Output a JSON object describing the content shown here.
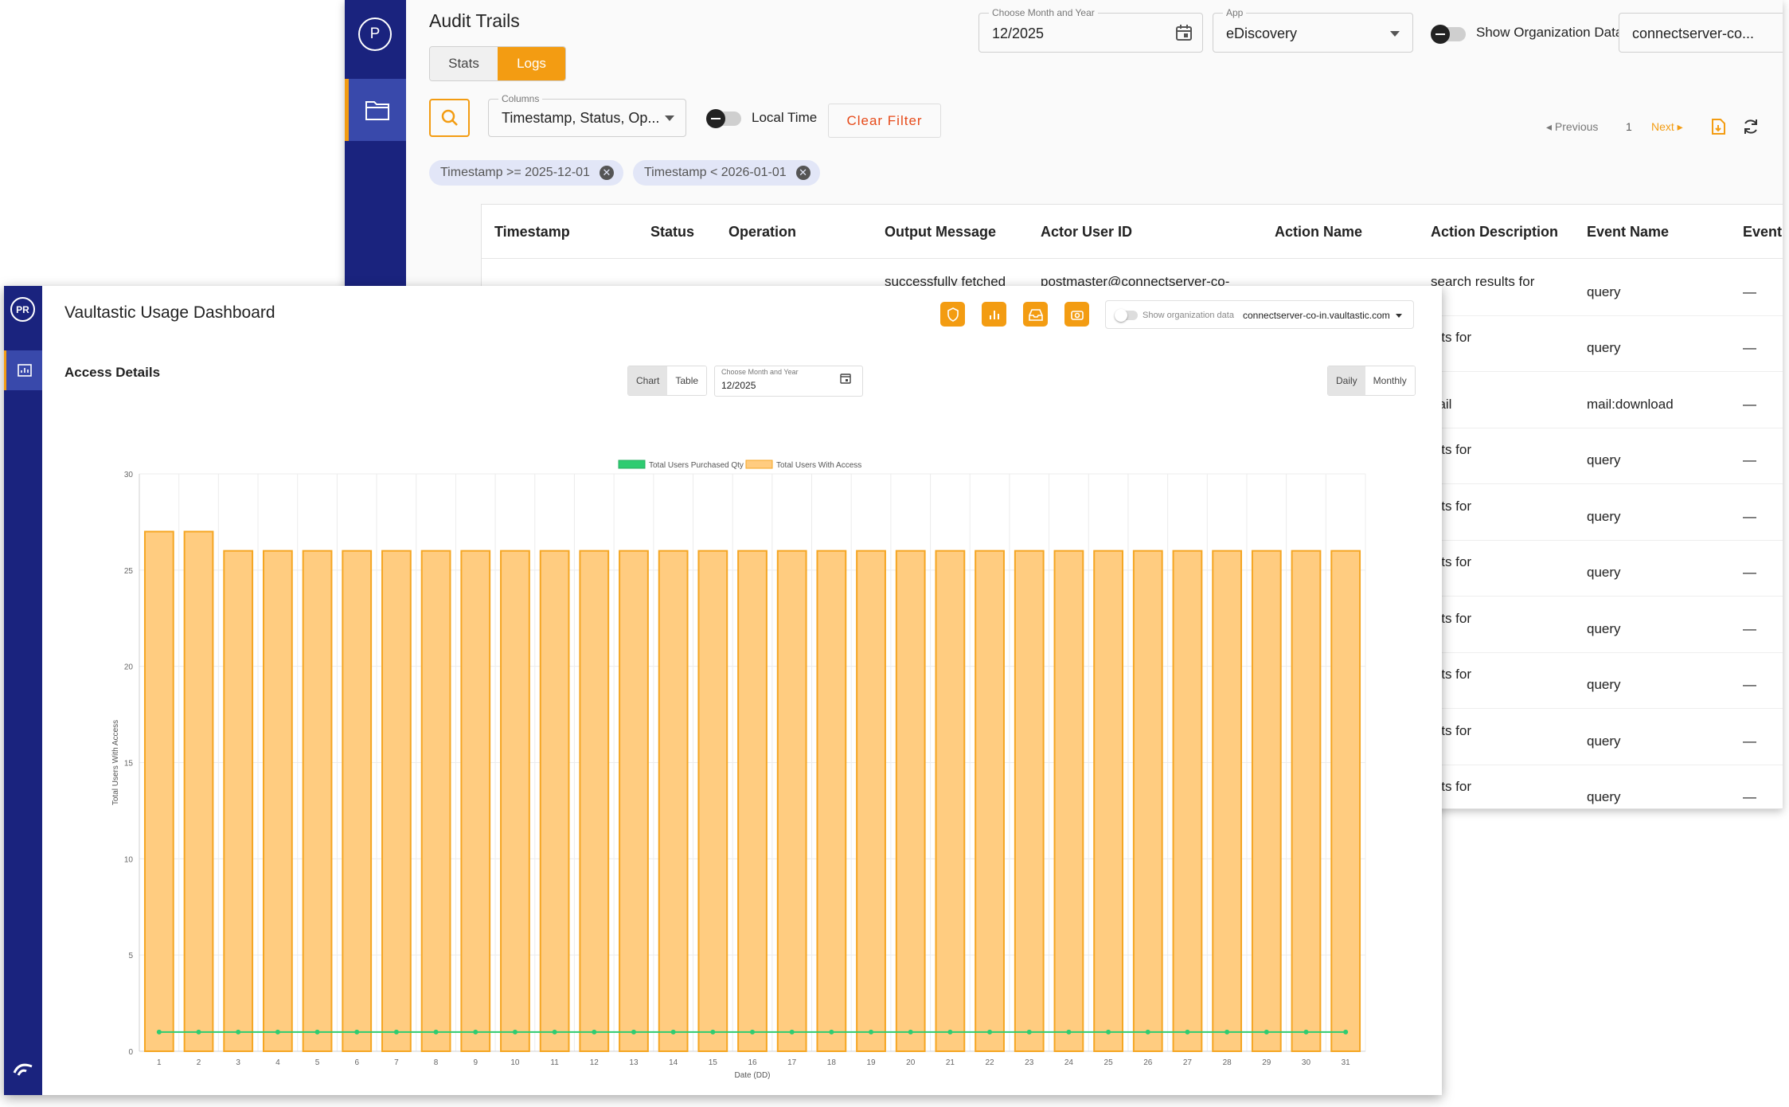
{
  "audit": {
    "rail_badge": "P",
    "title": "Audit Trails",
    "tabs": [
      "Stats",
      "Logs"
    ],
    "month_field": {
      "label": "Choose Month and Year",
      "value": "12/2025"
    },
    "app_field": {
      "label": "App",
      "value": "eDiscovery"
    },
    "org_toggle_label": "Show Organization Data",
    "org_select": "connectserver-co...",
    "columns_field": {
      "label": "Columns",
      "value": "Timestamp, Status, Op..."
    },
    "local_time_label": "Local Time",
    "clear_filter": "Clear Filter",
    "pager": {
      "previous": "Previous",
      "page": "1",
      "next": "Next"
    },
    "filters": [
      "Timestamp >= 2025-12-01",
      "Timestamp < 2026-01-01"
    ],
    "table": {
      "headers": [
        "Timestamp",
        "Status",
        "Operation",
        "Output Message",
        "Actor User ID",
        "Action Name",
        "Action Description",
        "Event Name",
        "Event Sourc"
      ],
      "first_row": {
        "output": "successfully fetched",
        "actor": "postmaster@connectserver-co-",
        "desc": "search results for",
        "event": "query",
        "source": "—"
      },
      "rows": [
        {
          "desc": "ults for",
          "event": "query",
          "source": "—"
        },
        {
          "desc": "nail",
          "event": "mail:download",
          "source": "—"
        },
        {
          "desc": "ults for",
          "event": "query",
          "source": "—"
        },
        {
          "desc": "ults for",
          "event": "query",
          "source": "—"
        },
        {
          "desc": "ults for",
          "event": "query",
          "source": "—"
        },
        {
          "desc": "ults for",
          "event": "query",
          "source": "—"
        },
        {
          "desc": "ults for",
          "event": "query",
          "source": "—"
        },
        {
          "desc": "ults for",
          "event": "query",
          "source": "—"
        },
        {
          "desc": "ults for",
          "event": "query",
          "source": "—"
        }
      ]
    }
  },
  "dash": {
    "rail_badge": "PR",
    "title": "Vaultastic Usage Dashboard",
    "subtitle": "Access Details",
    "view_tabs": [
      "Chart",
      "Table"
    ],
    "month_field": {
      "label": "Choose Month and Year",
      "value": "12/2025"
    },
    "period_tabs": [
      "Daily",
      "Monthly"
    ],
    "org_toggle_label": "Show organization data",
    "org_select": "connectserver-co-in.vaultastic.com",
    "colors": {
      "accent": "#f39c12",
      "rail": "#1a237e",
      "bar_fill": "#ffcc80",
      "bar_stroke": "#f5a623",
      "line": "#2ecc71"
    }
  },
  "chart_data": {
    "type": "bar",
    "xlabel": "Date (DD)",
    "ylabel": "Total Users With Access",
    "ylim": [
      0,
      30
    ],
    "yticks": [
      0,
      5,
      10,
      15,
      20,
      25,
      30
    ],
    "grid": true,
    "legend_placement": "top-center",
    "categories": [
      "1",
      "2",
      "3",
      "4",
      "5",
      "6",
      "7",
      "8",
      "9",
      "10",
      "11",
      "12",
      "13",
      "14",
      "15",
      "16",
      "17",
      "18",
      "19",
      "20",
      "21",
      "22",
      "23",
      "24",
      "25",
      "26",
      "27",
      "28",
      "29",
      "30",
      "31"
    ],
    "series": [
      {
        "name": "Total Users Purchased Qty",
        "kind": "line",
        "color": "#2ecc71",
        "values": [
          1,
          1,
          1,
          1,
          1,
          1,
          1,
          1,
          1,
          1,
          1,
          1,
          1,
          1,
          1,
          1,
          1,
          1,
          1,
          1,
          1,
          1,
          1,
          1,
          1,
          1,
          1,
          1,
          1,
          1,
          1
        ]
      },
      {
        "name": "Total Users With Access",
        "kind": "bar",
        "color": "#ffcc80",
        "values": [
          27,
          27,
          26,
          26,
          26,
          26,
          26,
          26,
          26,
          26,
          26,
          26,
          26,
          26,
          26,
          26,
          26,
          26,
          26,
          26,
          26,
          26,
          26,
          26,
          26,
          26,
          26,
          26,
          26,
          26,
          26
        ]
      }
    ]
  }
}
